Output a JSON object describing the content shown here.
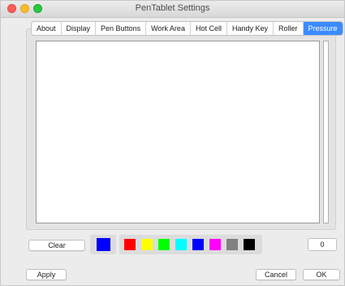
{
  "window": {
    "title": "PenTablet Settings"
  },
  "tabs": [
    {
      "label": "About"
    },
    {
      "label": "Display"
    },
    {
      "label": "Pen Buttons"
    },
    {
      "label": "Work Area"
    },
    {
      "label": "Hot Cell"
    },
    {
      "label": "Handy Key"
    },
    {
      "label": "Roller"
    },
    {
      "label": "Pressure"
    }
  ],
  "active_tab": "Pressure",
  "controls": {
    "clear_label": "Clear",
    "pressure_value": "0",
    "apply_label": "Apply",
    "cancel_label": "Cancel",
    "ok_label": "OK"
  },
  "selected_color": "#0000ff",
  "palette": [
    {
      "name": "red",
      "hex": "#ff0000"
    },
    {
      "name": "yellow",
      "hex": "#ffff00"
    },
    {
      "name": "green",
      "hex": "#00ff00"
    },
    {
      "name": "cyan",
      "hex": "#00ffff"
    },
    {
      "name": "blue",
      "hex": "#0000ff"
    },
    {
      "name": "magenta",
      "hex": "#ff00ff"
    },
    {
      "name": "gray",
      "hex": "#808080"
    },
    {
      "name": "black",
      "hex": "#000000"
    }
  ]
}
